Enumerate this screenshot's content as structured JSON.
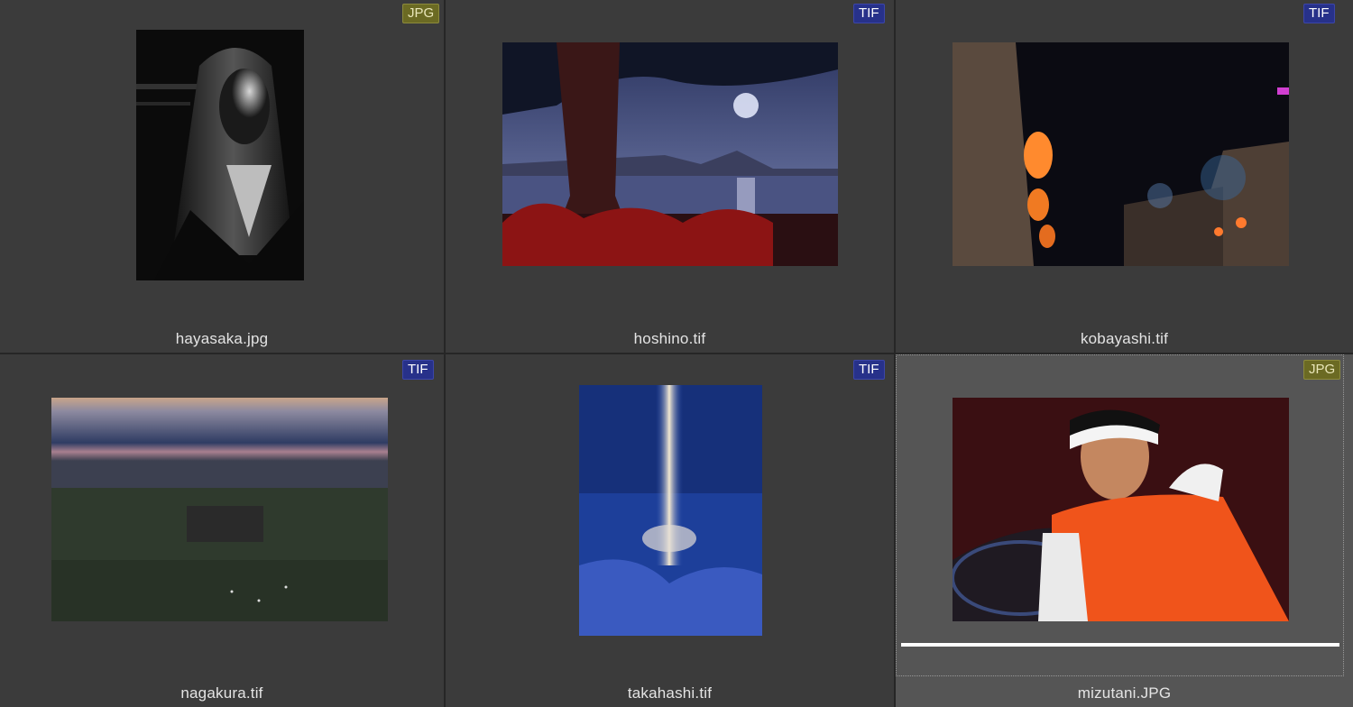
{
  "thumbnails": [
    {
      "filename": "hayasaka.jpg",
      "format": "JPG",
      "selected": false
    },
    {
      "filename": "hoshino.tif",
      "format": "TIF",
      "selected": false
    },
    {
      "filename": "kobayashi.tif",
      "format": "TIF",
      "selected": false
    },
    {
      "filename": "nagakura.tif",
      "format": "TIF",
      "selected": false
    },
    {
      "filename": "takahashi.tif",
      "format": "TIF",
      "selected": false
    },
    {
      "filename": "mizutani.JPG",
      "format": "JPG",
      "selected": true
    }
  ],
  "colors": {
    "background": "#3b3b3b",
    "selected_background": "#555555",
    "jpg_badge": "#6b6a23",
    "tif_badge": "#27318a"
  }
}
